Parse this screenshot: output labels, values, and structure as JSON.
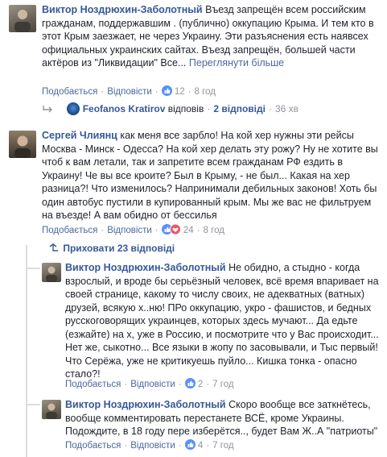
{
  "comments": [
    {
      "author": "Виктор Ноздрюхин-Заболотный",
      "text": "Въезд запрещён всем российским гражданам, поддержавшим . (публично) оккупацию Крыма. И тем кто в этот Крым заезжает, не через Украину. Эти разъяснения есть наявсех официальных украинских сайтах. Въезд запрещён, большей части актёров из \"Ликвидации\" Все...",
      "see_translation": "Переглянути більше",
      "like": "Подобається",
      "reply": "Відповісти",
      "reactions": "12",
      "time": "8 год"
    },
    {
      "author": "Сергей Члиянц",
      "text": "как меня все зарбло! На кой хер нужны эти рейсы Москва - Минск - Одесса? На кой хер делать эту рожу? Ну не хотите вы чтоб к вам летали, так и запретите всем гражданам РФ ездить в Украину! Че вы все кроите? Был в Крыму, - не был... Какая на хер разница?! Что изменилось? Напринимали дебильных законов! Хоть бы один автобус пустили в купированный крым. Мы же вас не фильтруем на въезде! А вам обидно от бессилья",
      "like": "Подобається",
      "reply": "Відповісти",
      "reactions": "24",
      "time": "8 год"
    }
  ],
  "reply_preview": {
    "name": "Feofanos Kratirov",
    "action": "відповів",
    "count": "2 відповіді",
    "time": "36 хв"
  },
  "hide_replies": "Приховати 23 відповіді",
  "replies": [
    {
      "author": "Виктор Ноздрюхин-Заболотный",
      "text": "Не обидно, а стыдно - когда взрослый, и вроде бы серьёзный человек, всё время впаривает на своей странице, какому то числу своих, не адекватных (ватных) друзей, всякую х..ню! ПРо оккупацию, укро - фашистов, и бедных русскоговорящих украинцев, которых здесь мучают... Да едьте (езжайте) на х, уже в Россию, и посмотрите что у Вас происходит... Нет же, сыкотно... Все языки в жопу по засовывали, и Тыс первый! Что Серёжа, уже не критикуешь пуйло... Кишка тонка - опасно стало?!",
      "like": "Подобається",
      "reply": "Відповісти",
      "reactions": "2",
      "time": "7 год"
    },
    {
      "author": "Виктор Ноздрюхин-Заболотный",
      "text": "Скоро вообще все заткнётесь, вообще комментировать перестанете ВСЁ, кроме Украины. Подождите, в 18 году пере изберётся.., будет Вам Ж..А \"патриоты\"",
      "like": "Подобається",
      "reply": "Відповісти",
      "reactions": "4",
      "time": "7 год"
    }
  ],
  "colors": {
    "link": "#365899",
    "meta": "#90949c",
    "text": "#1d2129",
    "like": "#5890ff",
    "love": "#f25268"
  },
  "icons": [
    "like-reaction-icon",
    "love-reaction-icon",
    "reply-arrow-icon",
    "collapse-arrow-icon"
  ]
}
